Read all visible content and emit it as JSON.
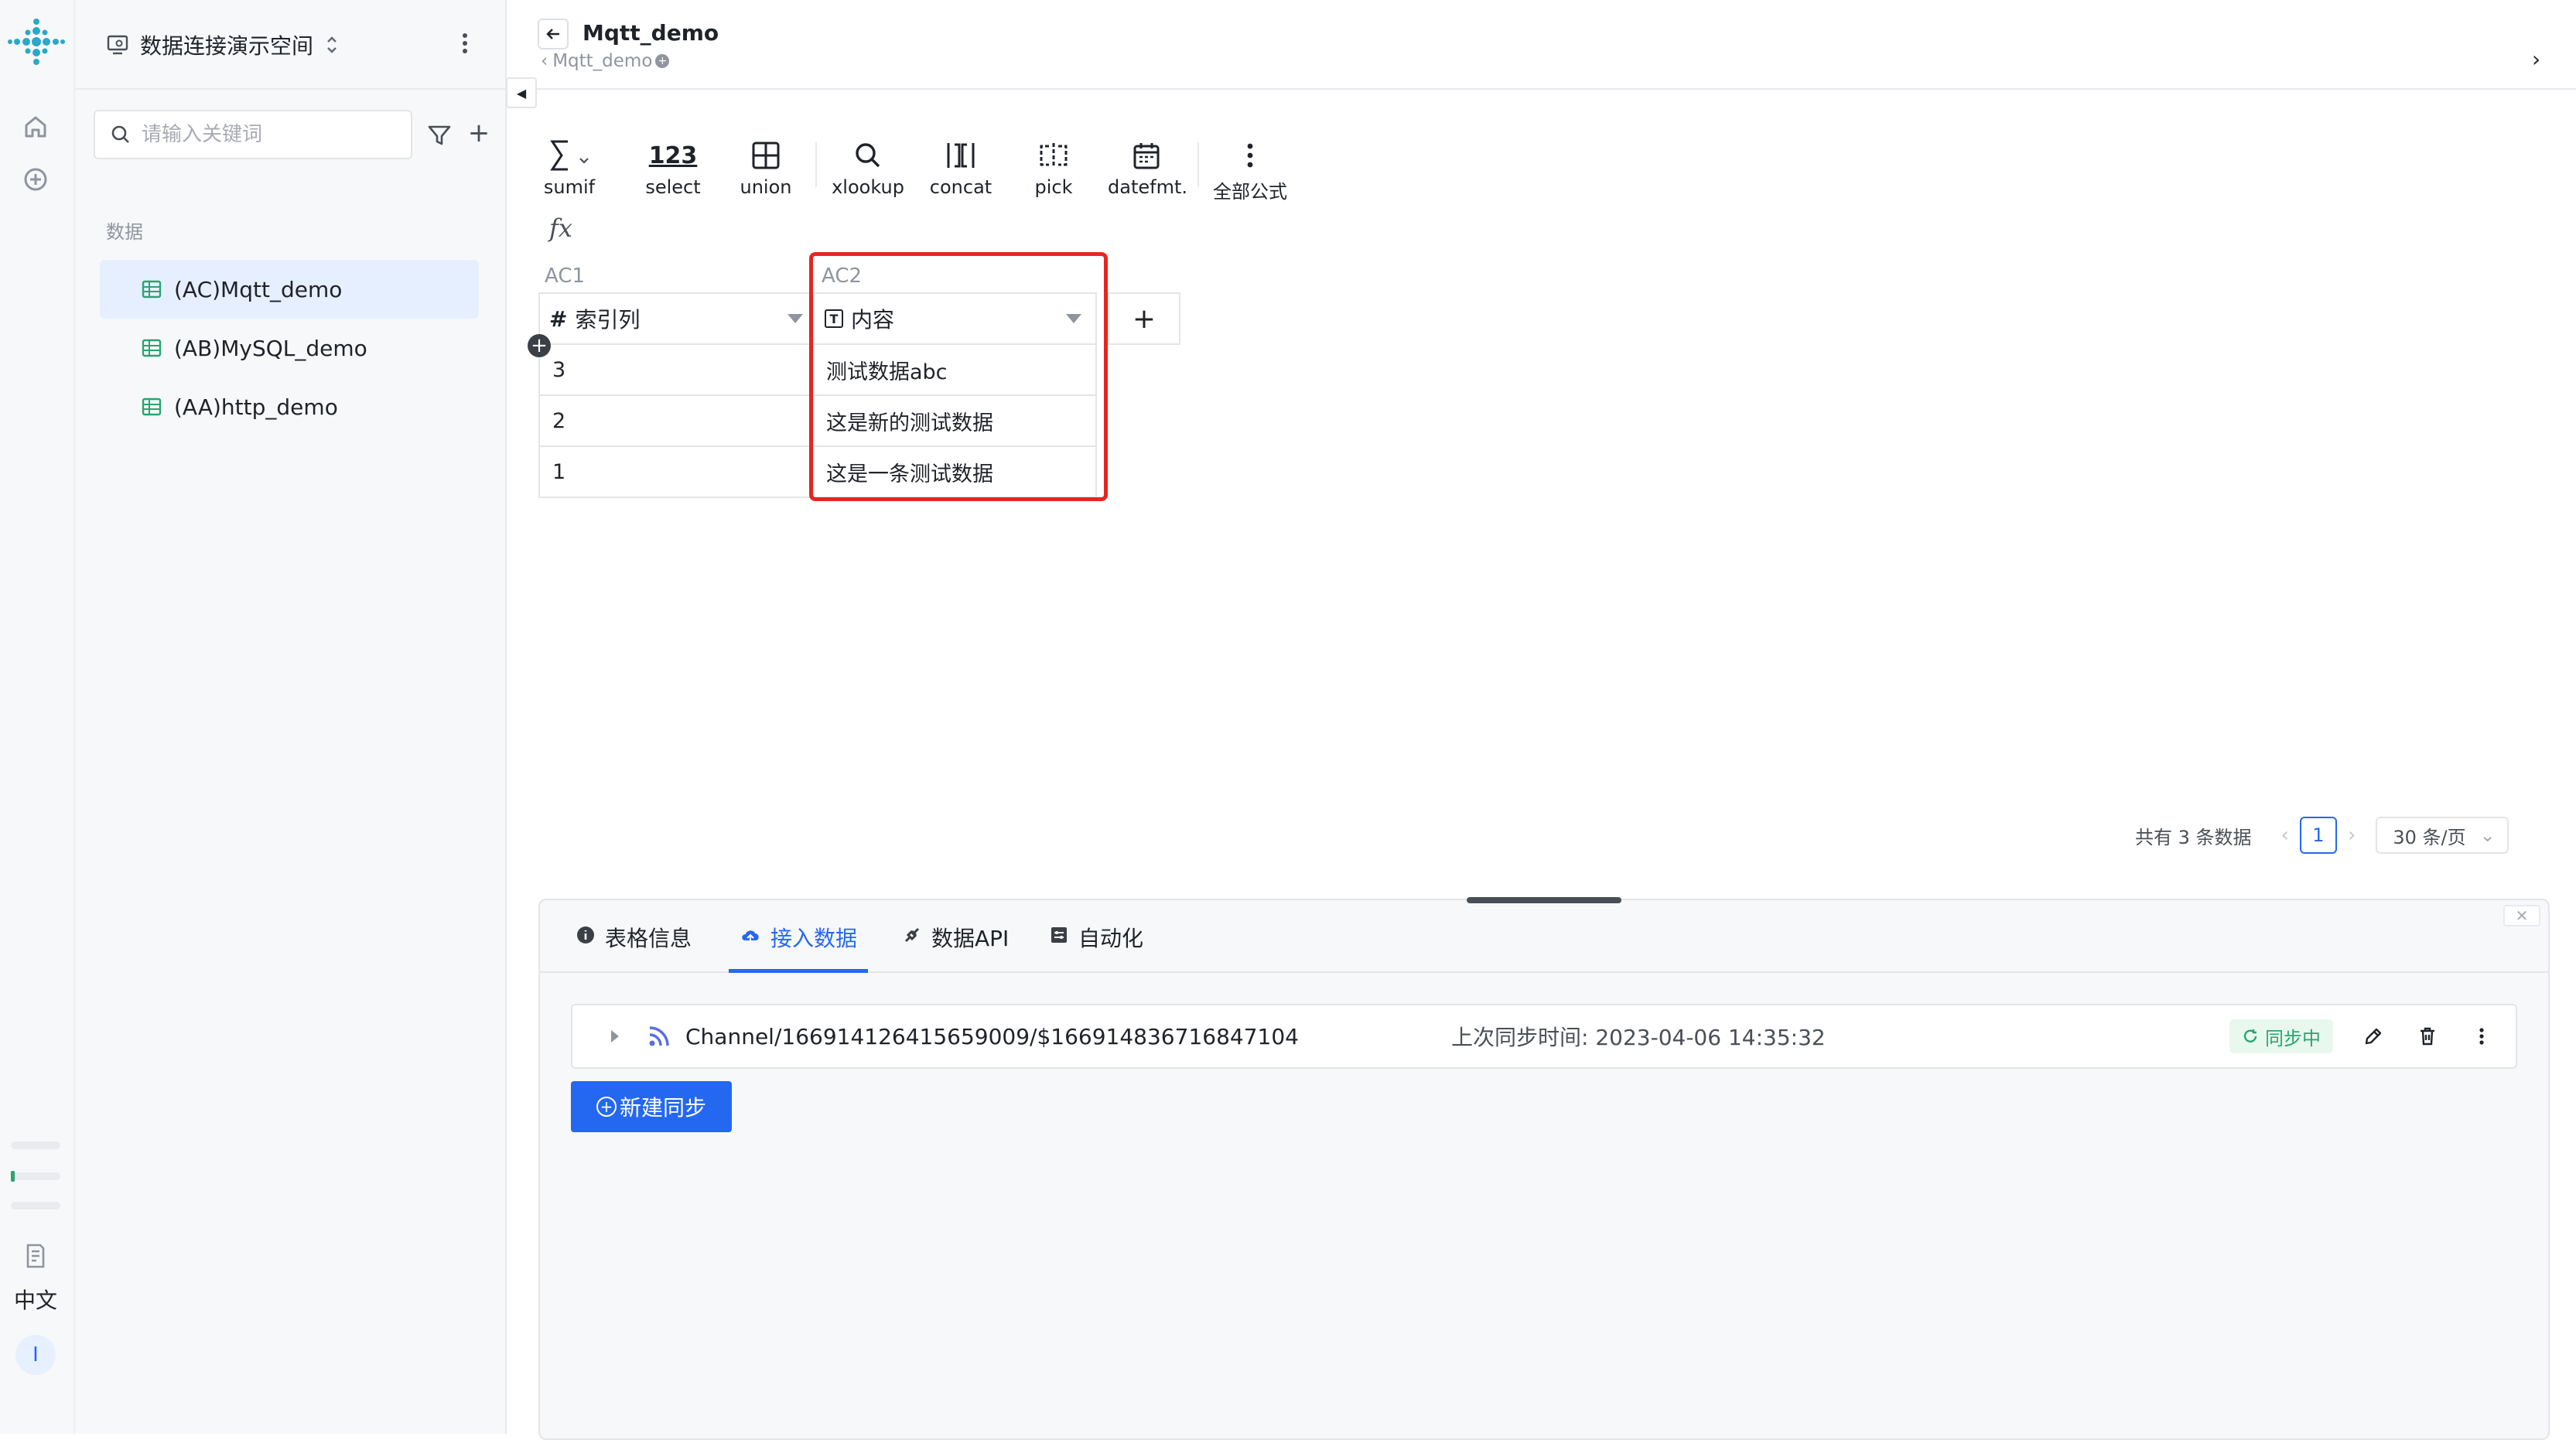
{
  "colors": {
    "accent": "#2468f2",
    "highlight": "#e5261f",
    "sync_green": "#2ba471",
    "table_icon": "#2ba471"
  },
  "rail": {
    "lang_label": "中文",
    "avatar_initial": "I"
  },
  "sidebar": {
    "workspace_name": "数据连接演示空间",
    "search_placeholder": "请输入关键词",
    "section_label": "数据",
    "items": [
      {
        "label": "(AC)Mqtt_demo",
        "active": true
      },
      {
        "label": "(AB)MySQL_demo",
        "active": false
      },
      {
        "label": "(AA)http_demo",
        "active": false
      }
    ]
  },
  "header": {
    "title": "Mqtt_demo",
    "breadcrumb": "Mqtt_demo"
  },
  "toolbar": {
    "tools": [
      {
        "label": "sumif",
        "icon": "sigma-icon"
      },
      {
        "label": "select",
        "icon": "number-123-icon"
      },
      {
        "label": "union",
        "icon": "union-icon"
      },
      {
        "label": "xlookup",
        "icon": "search-icon"
      },
      {
        "label": "concat",
        "icon": "concat-icon"
      },
      {
        "label": "pick",
        "icon": "pick-icon"
      },
      {
        "label": "datefmt.",
        "icon": "calendar-icon"
      },
      {
        "label": "全部公式",
        "icon": "more-vertical-icon"
      }
    ],
    "fx_label": "fx"
  },
  "grid": {
    "columns": [
      {
        "key": "AC1",
        "type_symbol": "#",
        "name": "索引列"
      },
      {
        "key": "AC2",
        "type_symbol": "T",
        "name": "内容"
      }
    ],
    "rows": [
      [
        "3",
        "测试数据abc"
      ],
      [
        "2",
        "这是新的测试数据"
      ],
      [
        "1",
        "这是一条测试数据"
      ]
    ],
    "add_column_label": "+"
  },
  "pagination": {
    "total_text": "共有 3 条数据",
    "current_page": "1",
    "page_size": "30 条/页"
  },
  "panel": {
    "tabs": [
      {
        "label": "表格信息",
        "active": false
      },
      {
        "label": "接入数据",
        "active": true
      },
      {
        "label": "数据API",
        "active": false
      },
      {
        "label": "自动化",
        "active": false
      }
    ],
    "sync": {
      "channel": "Channel/166914126415659009/$166914836716847104",
      "last_sync": "上次同步时间: 2023-04-06 14:35:32",
      "status": "同步中"
    },
    "new_sync_label": "新建同步"
  }
}
